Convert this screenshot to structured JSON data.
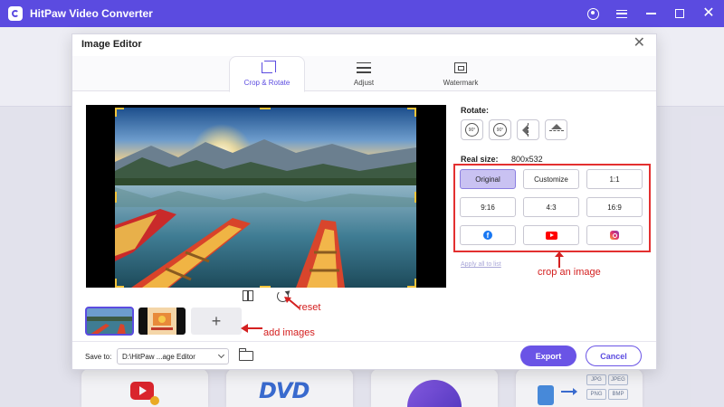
{
  "app": {
    "title": "HitPaw Video Converter"
  },
  "modal": {
    "title": "Image Editor",
    "tabs": [
      {
        "label": "Crop & Rotate",
        "active": true,
        "icon": "crop-icon"
      },
      {
        "label": "Adjust",
        "active": false,
        "icon": "adjust-icon"
      },
      {
        "label": "Watermark",
        "active": false,
        "icon": "watermark-icon"
      }
    ]
  },
  "rotate": {
    "label": "Rotate:",
    "buttons": [
      {
        "name": "rotate-left-90",
        "text": "90°"
      },
      {
        "name": "rotate-right-90",
        "text": "90°"
      },
      {
        "name": "flip-horizontal",
        "text": ""
      },
      {
        "name": "flip-vertical",
        "text": ""
      }
    ]
  },
  "realsize": {
    "label": "Real size:",
    "value": "800x532"
  },
  "ratios": [
    {
      "label": "Original",
      "active": true
    },
    {
      "label": "Customize",
      "active": false
    },
    {
      "label": "1:1",
      "active": false
    },
    {
      "label": "9:16",
      "active": false
    },
    {
      "label": "4:3",
      "active": false
    },
    {
      "label": "16:9",
      "active": false
    },
    {
      "label": "",
      "icon": "facebook-icon"
    },
    {
      "label": "",
      "icon": "youtube-icon"
    },
    {
      "label": "",
      "icon": "instagram-icon"
    }
  ],
  "apply_all": "Apply all to list",
  "annotations": {
    "crop": "crop an image",
    "reset": "reset",
    "add_images": "add images"
  },
  "footer": {
    "save_to_label": "Save to:",
    "save_path": "D:\\HitPaw ...age Editor",
    "export_label": "Export",
    "cancel_label": "Cancel"
  },
  "background_cards": {
    "dvd": "DVD",
    "formats": [
      "JPG",
      "JPEG",
      "PNG",
      "BMP"
    ]
  },
  "colors": {
    "accent": "#5b4be0",
    "annotation": "#d42020",
    "crop_handle": "#f3c43b"
  }
}
